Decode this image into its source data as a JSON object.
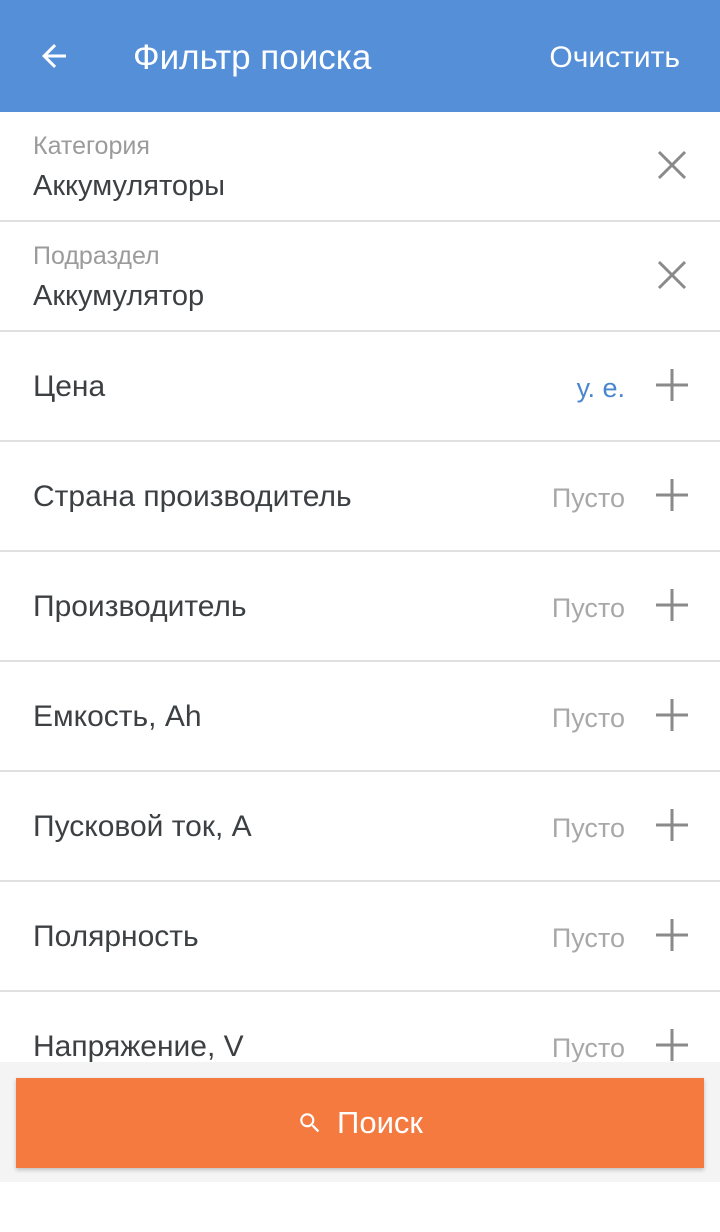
{
  "appbar": {
    "title": "Фильтр поиска",
    "clear_label": "Очистить"
  },
  "selected": [
    {
      "caption": "Категория",
      "value": "Аккумуляторы",
      "icon": "close-icon"
    },
    {
      "caption": "Подраздел",
      "value": "Аккумулятор",
      "icon": "close-icon"
    }
  ],
  "filters": [
    {
      "label": "Цена",
      "value": "у. е.",
      "accent": true,
      "icon": "plus-icon"
    },
    {
      "label": "Страна производитель",
      "value": "Пусто",
      "icon": "plus-icon"
    },
    {
      "label": "Производитель",
      "value": "Пусто",
      "icon": "plus-icon"
    },
    {
      "label": "Емкость, Ah",
      "value": "Пусто",
      "icon": "plus-icon"
    },
    {
      "label": "Пусковой ток, А",
      "value": "Пусто",
      "icon": "plus-icon"
    },
    {
      "label": "Полярность",
      "value": "Пусто",
      "icon": "plus-icon"
    },
    {
      "label": "Напряжение, V",
      "value": "Пусто",
      "icon": "plus-icon"
    }
  ],
  "search_button": {
    "label": "Поиск",
    "icon": "search-icon"
  },
  "colors": {
    "appbar": "#558fd8",
    "accent_text": "#4a86cf",
    "search_button": "#f47a40"
  }
}
